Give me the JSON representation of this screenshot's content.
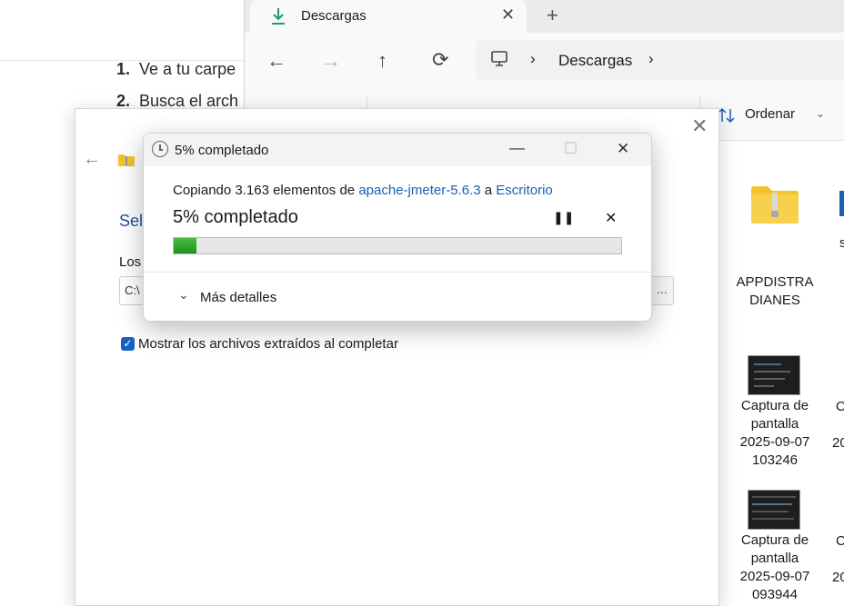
{
  "document": {
    "items": [
      {
        "number": "1.",
        "text": "Ve a tu carpe"
      },
      {
        "number": "2.",
        "text": "Busca el arch"
      }
    ]
  },
  "explorer": {
    "tab_title": "Descargas",
    "tab_close": "✕",
    "new_tab": "+",
    "nav": {
      "back": "←",
      "forward": "→",
      "up": "↑",
      "refresh": "⟳"
    },
    "address": {
      "crumb": "Descargas",
      "separator": "›"
    },
    "sort_label": "Ordenar",
    "files": [
      {
        "name_lines": [
          "APPDISTRA",
          "DIANES"
        ],
        "type": "zip-folder"
      },
      {
        "name_lines": [
          "Captura de",
          "pantalla",
          "2025-09-07",
          "103246"
        ],
        "type": "screenshot"
      },
      {
        "name_lines": [
          "Captura de",
          "pantalla",
          "2025-09-07",
          "093944"
        ],
        "type": "screenshot"
      }
    ],
    "partial_labels": {
      "col2_a": "s",
      "col2_b": "C",
      "col2_c": "20",
      "col2_d": "C",
      "col2_e": "20"
    }
  },
  "extract_dialog": {
    "heading_partial": "Sel",
    "label_partial": "Los",
    "path_partial": "C:\\",
    "browse_label": "...",
    "checkbox_checked": true,
    "checkbox_label": "Mostrar los archivos extraídos al completar"
  },
  "progress_dialog": {
    "title": "5% completado",
    "copy_prefix": "Copiando 3.163 elementos de ",
    "source": "apache-jmeter-5.6.3",
    "copy_mid": " a ",
    "destination": "Escritorio",
    "status": "5% completado",
    "percent": 5,
    "pause": "⏸",
    "cancel": "✕",
    "more_details": "Más detalles",
    "controls": {
      "minimize": "—",
      "maximize": "☐",
      "close": "✕"
    }
  },
  "colors": {
    "accent": "#1a5fb4",
    "progress_green": "#2fa82f",
    "checkbox": "#1763c4",
    "folder": "#f3c22f"
  }
}
